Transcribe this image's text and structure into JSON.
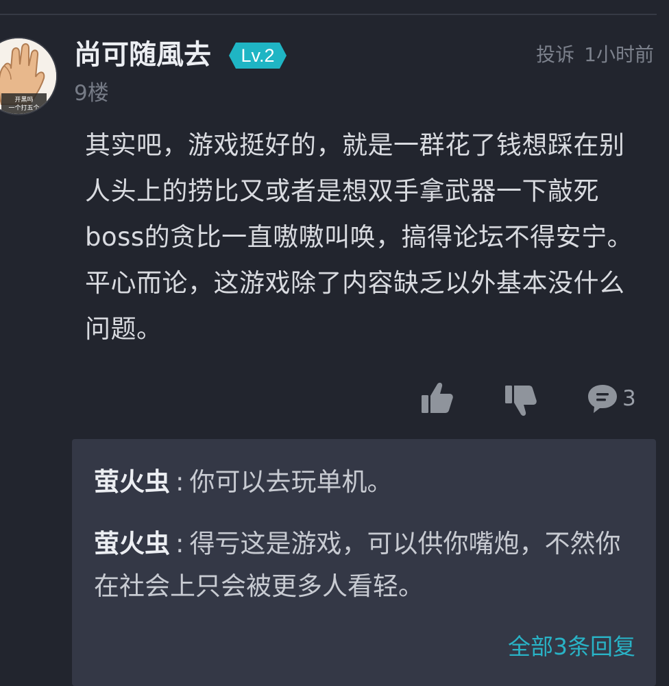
{
  "post": {
    "username": "尚可随風去",
    "level": "Lv.2",
    "floor": "9楼",
    "report_label": "投诉",
    "time": "1小时前",
    "content": "其实吧，游戏挺好的，就是一群花了钱想踩在别人头上的捞比又或者是想双手拿武器一下敲死boss的贪比一直嗷嗷叫唤，搞得论坛不得安宁。平心而论，这游戏除了内容缺乏以外基本没什么问题。",
    "avatar_caption_line1": "开黑吗",
    "avatar_caption_line2": "一个打五个"
  },
  "actions": {
    "like_icon": "thumbs-up-icon",
    "dislike_icon": "thumbs-down-icon",
    "reply_icon": "comment-bubble-icon",
    "reply_count": "3"
  },
  "replies": [
    {
      "author": "萤火虫",
      "separator": ":",
      "text": "你可以去玩单机。"
    },
    {
      "author": "萤火虫",
      "separator": ":",
      "text": "得亏这是游戏，可以供你嘴炮，不然你在社会上只会被更多人看轻。"
    }
  ],
  "view_all_label": "全部3条回复",
  "colors": {
    "background": "#22252e",
    "reply_panel": "#343846",
    "level_badge": "#1fb5c4",
    "link": "#29b3c6"
  }
}
